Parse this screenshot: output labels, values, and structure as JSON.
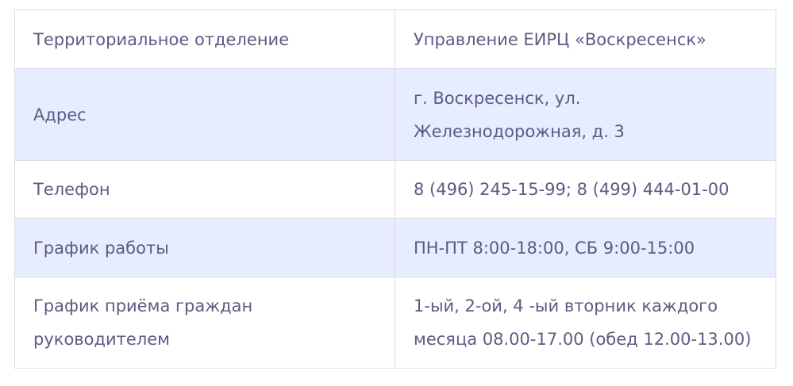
{
  "rows": [
    {
      "label": "Территориальное отделение",
      "value": "Управление ЕИРЦ «Воскресенск»"
    },
    {
      "label": "Адрес",
      "value": "г. Воскресенск, ул. Железнодорожная, д. 3"
    },
    {
      "label": "Телефон",
      "value": "8 (496) 245-15-99; 8 (499) 444-01-00"
    },
    {
      "label": "График работы",
      "value": "ПН-ПТ 8:00-18:00, СБ 9:00-15:00"
    },
    {
      "label": "График приёма граждан руководителем",
      "value": "1-ый, 2-ой, 4 -ый вторник каждого месяца 08.00-17.00 (обед 12.00-13.00)"
    }
  ],
  "colors": {
    "text": "#5b5c83",
    "border": "#dcdde6",
    "stripe": "#e7ecfe",
    "background": "#ffffff"
  }
}
